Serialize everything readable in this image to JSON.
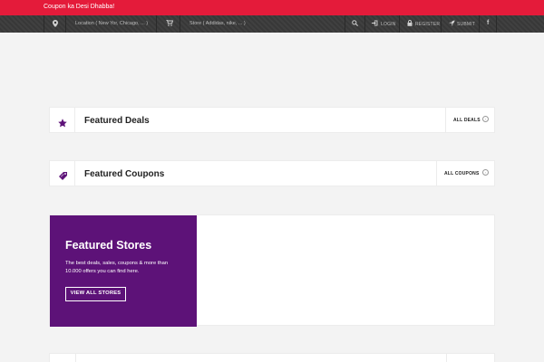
{
  "header": {
    "brand": "Coupon ka Desi Dhabba!",
    "colors": {
      "topbar": "#e41b3a",
      "searchbar": "#3a3a3a"
    }
  },
  "search": {
    "location_icon": "map-marker-icon",
    "location_placeholder": "Location ( New Yor, Chicago, ... )",
    "store_icon": "cart-icon",
    "store_placeholder": "Store ( Addidas, nike, ... )"
  },
  "nav": {
    "search_icon": "search-icon",
    "login_label": "LOGIN",
    "register_label": "REGISTER",
    "submit_label": "SUBMIT",
    "facebook_icon": "facebook-icon"
  },
  "featured_deals": {
    "title": "Featured Deals",
    "action": "ALL DEALS",
    "icon": "star-icon"
  },
  "featured_coupons": {
    "title": "Featured Coupons",
    "action": "ALL COUPONS",
    "icon": "coupon-tag-icon"
  },
  "featured_stores": {
    "title": "Featured Stores",
    "description": "The best deals, sales, coupons & more than 10.000 offers you can find here.",
    "button": "VIEW ALL STORES",
    "color": "#5d1278"
  }
}
